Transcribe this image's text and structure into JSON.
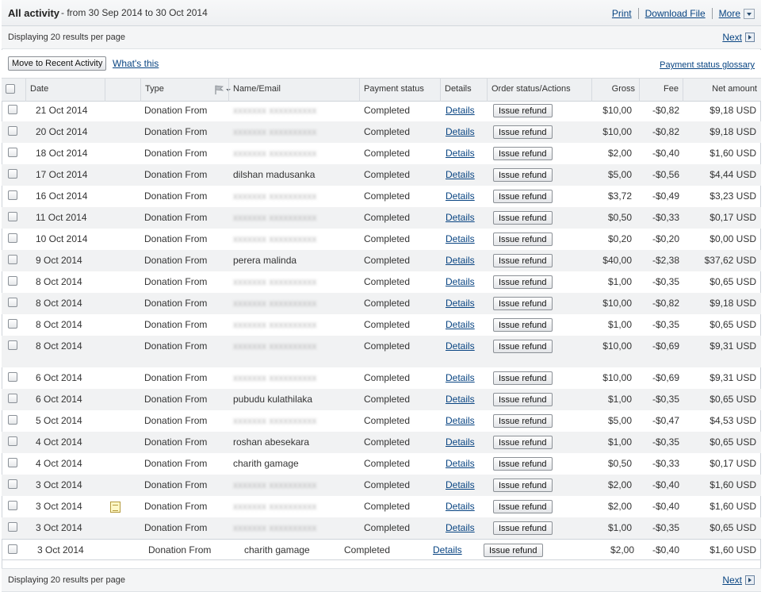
{
  "header": {
    "title": "All activity",
    "range": "- from 30 Sep 2014 to 30 Oct 2014",
    "print": "Print",
    "download": "Download File",
    "more": "More"
  },
  "pager": {
    "text": "Displaying 20 results per page",
    "next": "Next"
  },
  "toolbar": {
    "move_button": "Move to Recent Activity",
    "whats_this": "What's this",
    "glossary": "Payment status glossary"
  },
  "columns": {
    "date": "Date",
    "type": "Type",
    "name": "Name/Email",
    "status": "Payment status",
    "details": "Details",
    "order": "Order status/Actions",
    "gross": "Gross",
    "fee": "Fee",
    "net": "Net amount"
  },
  "rows": [
    {
      "date": "21 Oct 2014",
      "type": "Donation From",
      "name": "",
      "status": "Completed",
      "details": "Details",
      "action": "Issue refund",
      "gross": "$10,00",
      "fee": "-$0,82",
      "net": "$9,18 USD"
    },
    {
      "date": "20 Oct 2014",
      "type": "Donation From",
      "name": "",
      "status": "Completed",
      "details": "Details",
      "action": "Issue refund",
      "gross": "$10,00",
      "fee": "-$0,82",
      "net": "$9,18 USD"
    },
    {
      "date": "18 Oct 2014",
      "type": "Donation From",
      "name": "",
      "status": "Completed",
      "details": "Details",
      "action": "Issue refund",
      "gross": "$2,00",
      "fee": "-$0,40",
      "net": "$1,60 USD"
    },
    {
      "date": "17 Oct 2014",
      "type": "Donation From",
      "name": "dilshan madusanka",
      "status": "Completed",
      "details": "Details",
      "action": "Issue refund",
      "gross": "$5,00",
      "fee": "-$0,56",
      "net": "$4,44 USD"
    },
    {
      "date": "16 Oct 2014",
      "type": "Donation From",
      "name": "",
      "status": "Completed",
      "details": "Details",
      "action": "Issue refund",
      "gross": "$3,72",
      "fee": "-$0,49",
      "net": "$3,23 USD"
    },
    {
      "date": "11 Oct 2014",
      "type": "Donation From",
      "name": "",
      "status": "Completed",
      "details": "Details",
      "action": "Issue refund",
      "gross": "$0,50",
      "fee": "-$0,33",
      "net": "$0,17 USD"
    },
    {
      "date": "10 Oct 2014",
      "type": "Donation From",
      "name": "",
      "status": "Completed",
      "details": "Details",
      "action": "Issue refund",
      "gross": "$0,20",
      "fee": "-$0,20",
      "net": "$0,00 USD"
    },
    {
      "date": "9 Oct 2014",
      "type": "Donation From",
      "name": "perera malinda",
      "status": "Completed",
      "details": "Details",
      "action": "Issue refund",
      "gross": "$40,00",
      "fee": "-$2,38",
      "net": "$37,62 USD"
    },
    {
      "date": "8 Oct 2014",
      "type": "Donation From",
      "name": "",
      "status": "Completed",
      "details": "Details",
      "action": "Issue refund",
      "gross": "$1,00",
      "fee": "-$0,35",
      "net": "$0,65 USD"
    },
    {
      "date": "8 Oct 2014",
      "type": "Donation From",
      "name": "",
      "status": "Completed",
      "details": "Details",
      "action": "Issue refund",
      "gross": "$10,00",
      "fee": "-$0,82",
      "net": "$9,18 USD"
    },
    {
      "date": "8 Oct 2014",
      "type": "Donation From",
      "name": "",
      "status": "Completed",
      "details": "Details",
      "action": "Issue refund",
      "gross": "$1,00",
      "fee": "-$0,35",
      "net": "$0,65 USD"
    },
    {
      "date": "8 Oct 2014",
      "type": "Donation From",
      "name": "",
      "status": "Completed",
      "details": "Details",
      "action": "Issue refund",
      "gross": "$10,00",
      "fee": "-$0,69",
      "net": "$9,31 USD"
    },
    {
      "date": "6 Oct 2014",
      "type": "Donation From",
      "name": "",
      "status": "Completed",
      "details": "Details",
      "action": "Issue refund",
      "gross": "$10,00",
      "fee": "-$0,69",
      "net": "$9,31 USD"
    },
    {
      "date": "6 Oct 2014",
      "type": "Donation From",
      "name": "pubudu kulathilaka",
      "status": "Completed",
      "details": "Details",
      "action": "Issue refund",
      "gross": "$1,00",
      "fee": "-$0,35",
      "net": "$0,65 USD"
    },
    {
      "date": "5 Oct 2014",
      "type": "Donation From",
      "name": "",
      "status": "Completed",
      "details": "Details",
      "action": "Issue refund",
      "gross": "$5,00",
      "fee": "-$0,47",
      "net": "$4,53 USD"
    },
    {
      "date": "4 Oct 2014",
      "type": "Donation From",
      "name": "roshan abesekara",
      "status": "Completed",
      "details": "Details",
      "action": "Issue refund",
      "gross": "$1,00",
      "fee": "-$0,35",
      "net": "$0,65 USD"
    },
    {
      "date": "4 Oct 2014",
      "type": "Donation From",
      "name": "charith gamage",
      "status": "Completed",
      "details": "Details",
      "action": "Issue refund",
      "gross": "$0,50",
      "fee": "-$0,33",
      "net": "$0,17 USD"
    },
    {
      "date": "3 Oct 2014",
      "type": "Donation From",
      "name": "",
      "status": "Completed",
      "details": "Details",
      "action": "Issue refund",
      "gross": "$2,00",
      "fee": "-$0,40",
      "net": "$1,60 USD"
    },
    {
      "date": "3 Oct 2014",
      "type": "Donation From",
      "name": "",
      "status": "Completed",
      "details": "Details",
      "action": "Issue refund",
      "gross": "$2,00",
      "fee": "-$0,40",
      "net": "$1,60 USD",
      "has_note": true
    },
    {
      "date": "3 Oct 2014",
      "type": "Donation From",
      "name": "",
      "status": "Completed",
      "details": "Details",
      "action": "Issue refund",
      "gross": "$1,00",
      "fee": "-$0,35",
      "net": "$0,65 USD"
    },
    {
      "date": "3 Oct 2014",
      "type": "Donation From",
      "name": "charith gamage",
      "status": "Completed",
      "details": "Details",
      "action": "Issue refund",
      "gross": "$2,00",
      "fee": "-$0,40",
      "net": "$1,60 USD",
      "shifted": true
    }
  ]
}
